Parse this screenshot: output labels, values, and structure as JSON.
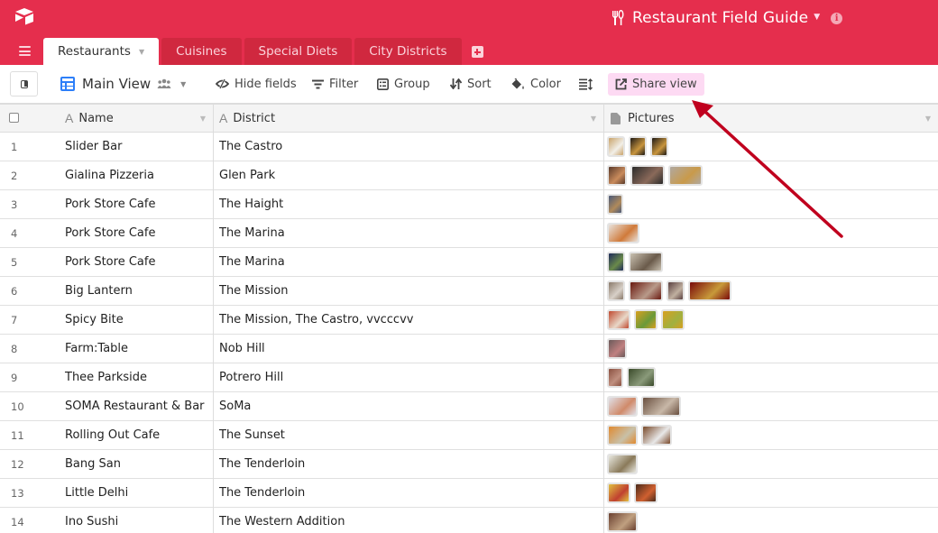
{
  "app": {
    "logo_icon": "airtable-box-icon",
    "base_title": "Restaurant Field Guide",
    "base_icon": "utensils-icon",
    "info_icon": "info-icon",
    "brand_color": "#e52e4d"
  },
  "tabs": [
    {
      "label": "Restaurants",
      "active": true
    },
    {
      "label": "Cuisines",
      "active": false
    },
    {
      "label": "Special Diets",
      "active": false
    },
    {
      "label": "City Districts",
      "active": false
    }
  ],
  "toolbar": {
    "view_name": "Main View",
    "hide_fields": "Hide fields",
    "filter": "Filter",
    "group": "Group",
    "sort": "Sort",
    "color": "Color",
    "share_view": "Share view",
    "share_highlight_color": "#fddaf3"
  },
  "columns": [
    {
      "label": "Name",
      "type": "text"
    },
    {
      "label": "District",
      "type": "text"
    },
    {
      "label": "Pictures",
      "type": "attachment"
    }
  ],
  "rows": [
    {
      "num": "1",
      "name": "Slider Bar",
      "district": "The Castro",
      "pictures": [
        {
          "w": 20,
          "c1": "#c9a36a",
          "c2": "#f2efe8"
        },
        {
          "w": 20,
          "c1": "#1f1a16",
          "c2": "#c8953e"
        },
        {
          "w": 20,
          "c1": "#1f1a16",
          "c2": "#c8953e"
        }
      ]
    },
    {
      "num": "2",
      "name": "Gialina Pizzeria",
      "district": "Glen Park",
      "pictures": [
        {
          "w": 22,
          "c1": "#5a3a2a",
          "c2": "#c98b5c"
        },
        {
          "w": 38,
          "c1": "#2b2b2b",
          "c2": "#8a6a5a"
        },
        {
          "w": 38,
          "c1": "#b0a8a0",
          "c2": "#c99a4a"
        }
      ]
    },
    {
      "num": "3",
      "name": "Pork Store Cafe",
      "district": "The Haight",
      "pictures": [
        {
          "w": 18,
          "c1": "#4a5a7a",
          "c2": "#b08a5a"
        }
      ]
    },
    {
      "num": "4",
      "name": "Pork Store Cafe",
      "district": "The Marina",
      "pictures": [
        {
          "w": 36,
          "c1": "#e8e2dc",
          "c2": "#d07a3a"
        }
      ]
    },
    {
      "num": "5",
      "name": "Pork Store Cafe",
      "district": "The Marina",
      "pictures": [
        {
          "w": 20,
          "c1": "#1e2a5a",
          "c2": "#6a8a4a"
        },
        {
          "w": 38,
          "c1": "#c8c0b0",
          "c2": "#6a5a4a"
        }
      ]
    },
    {
      "num": "6",
      "name": "Big Lantern",
      "district": "The Mission",
      "pictures": [
        {
          "w": 20,
          "c1": "#8a7a6a",
          "c2": "#d8d0c8"
        },
        {
          "w": 38,
          "c1": "#6a1a10",
          "c2": "#b89a8a"
        },
        {
          "w": 20,
          "c1": "#5a4040",
          "c2": "#c0b0a0"
        },
        {
          "w": 48,
          "c1": "#7a0a0a",
          "c2": "#c89a3a"
        }
      ]
    },
    {
      "num": "7",
      "name": "Spicy Bite",
      "district": "The Mission, The Castro, vvcccvv",
      "pictures": [
        {
          "w": 26,
          "c1": "#c04a30",
          "c2": "#e8d8c8"
        },
        {
          "w": 26,
          "c1": "#d8a020",
          "c2": "#6a9a3a"
        },
        {
          "w": 26,
          "c1": "#d8a020",
          "c2": "#a0b040"
        }
      ]
    },
    {
      "num": "8",
      "name": "Farm:Table",
      "district": "Nob Hill",
      "pictures": [
        {
          "w": 22,
          "c1": "#6a5a5a",
          "c2": "#c08080"
        }
      ]
    },
    {
      "num": "9",
      "name": "Thee Parkside",
      "district": "Potrero Hill",
      "pictures": [
        {
          "w": 18,
          "c1": "#8a5040",
          "c2": "#c09080"
        },
        {
          "w": 32,
          "c1": "#3a4a2a",
          "c2": "#8a9a7a"
        }
      ]
    },
    {
      "num": "10",
      "name": "SOMA Restaurant & Bar",
      "district": "SoMa",
      "pictures": [
        {
          "w": 34,
          "c1": "#e0e0e8",
          "c2": "#d08a6a"
        },
        {
          "w": 44,
          "c1": "#6a5040",
          "c2": "#c8b8a8"
        }
      ]
    },
    {
      "num": "11",
      "name": "Rolling Out Cafe",
      "district": "The Sunset",
      "pictures": [
        {
          "w": 34,
          "c1": "#e08a30",
          "c2": "#c8c0a8"
        },
        {
          "w": 34,
          "c1": "#7a4a2a",
          "c2": "#e8e8e8"
        }
      ]
    },
    {
      "num": "12",
      "name": "Bang San",
      "district": "The Tenderloin",
      "pictures": [
        {
          "w": 34,
          "c1": "#e8e8e0",
          "c2": "#8a7a5a"
        }
      ]
    },
    {
      "num": "13",
      "name": "Little Delhi",
      "district": "The Tenderloin",
      "pictures": [
        {
          "w": 26,
          "c1": "#e0c040",
          "c2": "#c04030"
        },
        {
          "w": 26,
          "c1": "#4a2a1a",
          "c2": "#d06030"
        }
      ]
    },
    {
      "num": "14",
      "name": "Ino Sushi",
      "district": "The Western Addition",
      "pictures": [
        {
          "w": 34,
          "c1": "#6a4030",
          "c2": "#c0a080"
        }
      ]
    }
  ],
  "annotation": {
    "type": "arrow",
    "color": "#c0001e",
    "points_to": "Share view"
  }
}
